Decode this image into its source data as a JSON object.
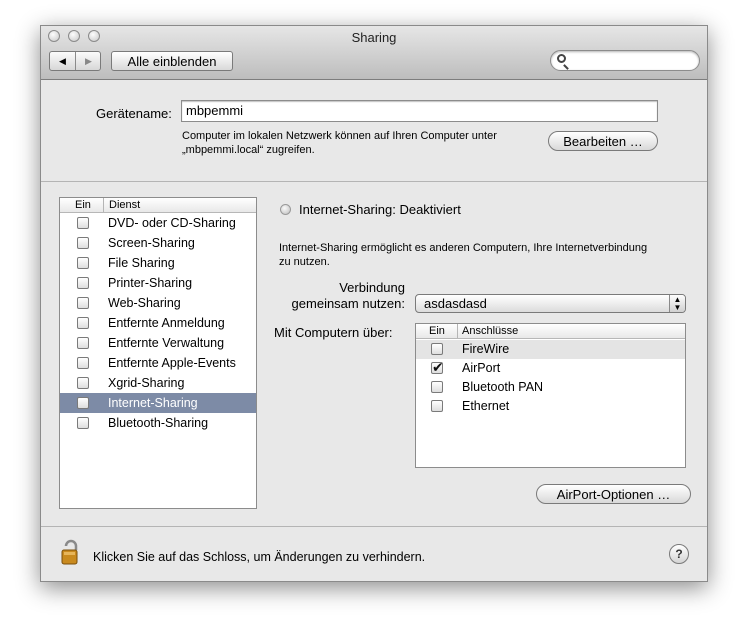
{
  "window": {
    "title": "Sharing"
  },
  "toolbar": {
    "show_all_label": "Alle einblenden",
    "back_glyph": "◀",
    "forward_glyph": "▶"
  },
  "search": {
    "placeholder": ""
  },
  "device": {
    "label": "Gerätename:",
    "value": "mbpemmi",
    "help_line1": "Computer im lokalen Netzwerk können auf Ihren Computer unter",
    "help_line2": "„mbpemmi.local“ zugreifen.",
    "edit_label": "Bearbeiten …"
  },
  "services": {
    "col_on": "Ein",
    "col_service": "Dienst",
    "items": [
      {
        "label": "DVD- oder CD-Sharing",
        "checked": false,
        "selected": false
      },
      {
        "label": "Screen-Sharing",
        "checked": false,
        "selected": false
      },
      {
        "label": "File Sharing",
        "checked": false,
        "selected": false
      },
      {
        "label": "Printer-Sharing",
        "checked": false,
        "selected": false
      },
      {
        "label": "Web-Sharing",
        "checked": false,
        "selected": false
      },
      {
        "label": "Entfernte Anmeldung",
        "checked": false,
        "selected": false
      },
      {
        "label": "Entfernte Verwaltung",
        "checked": false,
        "selected": false
      },
      {
        "label": "Entfernte Apple-Events",
        "checked": false,
        "selected": false
      },
      {
        "label": "Xgrid-Sharing",
        "checked": false,
        "selected": false
      },
      {
        "label": "Internet-Sharing",
        "checked": false,
        "selected": true
      },
      {
        "label": "Bluetooth-Sharing",
        "checked": false,
        "selected": false
      }
    ]
  },
  "detail": {
    "status": "Internet-Sharing: Deaktiviert",
    "description_line1": "Internet-Sharing ermöglicht es anderen Computern, Ihre Internetverbindung",
    "description_line2": "zu nutzen.",
    "share_label_line1": "Verbindung",
    "share_label_line2": "gemeinsam nutzen:",
    "share_value": "asdasdasd",
    "to_label": "Mit Computern über:",
    "ports_col_on": "Ein",
    "ports_col_name": "Anschlüsse",
    "ports": [
      {
        "label": "FireWire",
        "checked": false,
        "highlighted": true
      },
      {
        "label": "AirPort",
        "checked": true,
        "highlighted": false
      },
      {
        "label": "Bluetooth PAN",
        "checked": false,
        "highlighted": false
      },
      {
        "label": "Ethernet",
        "checked": false,
        "highlighted": false
      }
    ],
    "airport_options_label": "AirPort-Optionen …"
  },
  "footer": {
    "lock_text": "Klicken Sie auf das Schloss, um Änderungen zu verhindern.",
    "help_glyph": "?"
  },
  "colors": {
    "selection": "#7d8ba6",
    "port_highlight": "#e4e4e4",
    "window_bg": "#e8e8e8"
  }
}
